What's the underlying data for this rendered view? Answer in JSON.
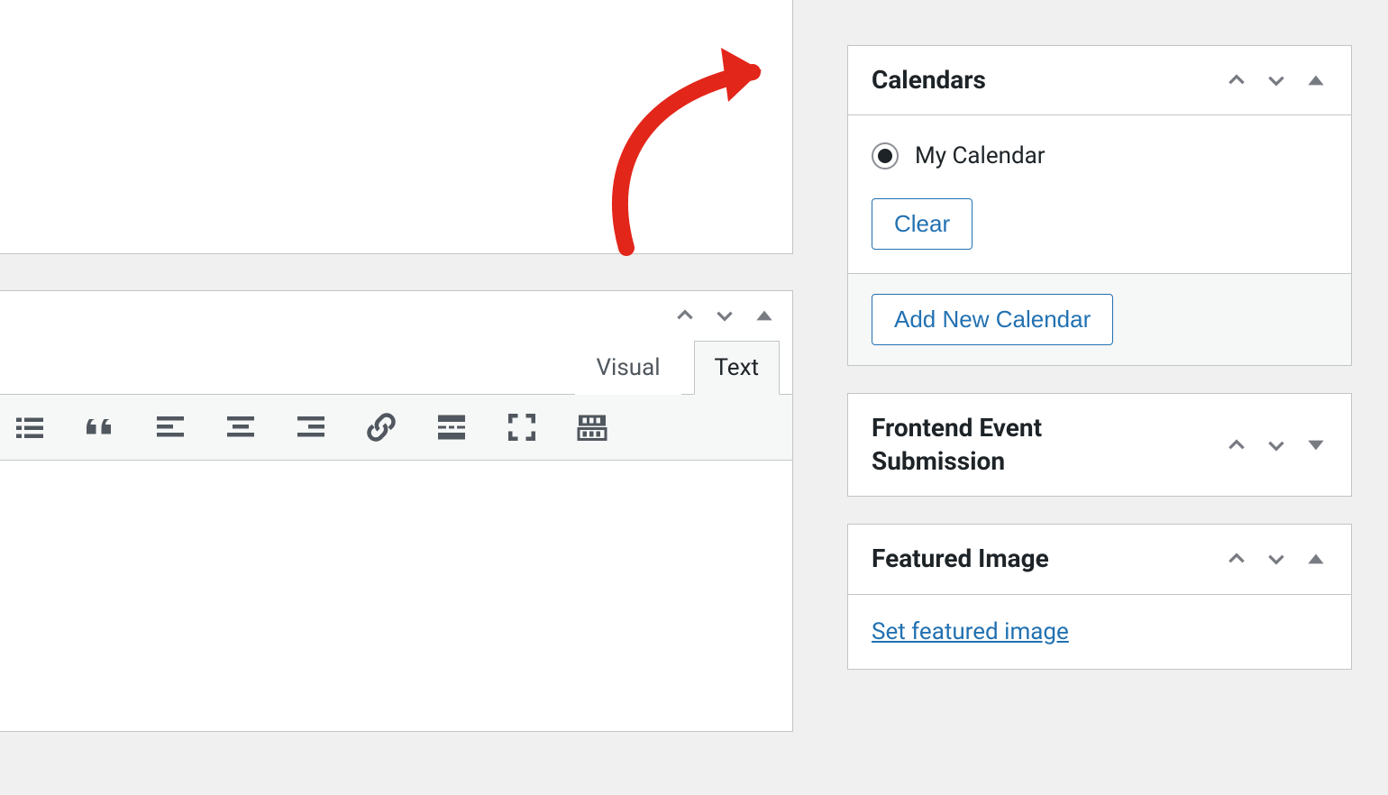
{
  "editor": {
    "tabs": {
      "visual": "Visual",
      "text": "Text"
    }
  },
  "sidebar": {
    "calendars": {
      "title": "Calendars",
      "option1_label": "My Calendar",
      "clear_label": "Clear",
      "add_label": "Add New Calendar"
    },
    "frontend": {
      "title": "Frontend Event Submission"
    },
    "featured": {
      "title": "Featured Image",
      "set_link": "Set featured image"
    }
  }
}
